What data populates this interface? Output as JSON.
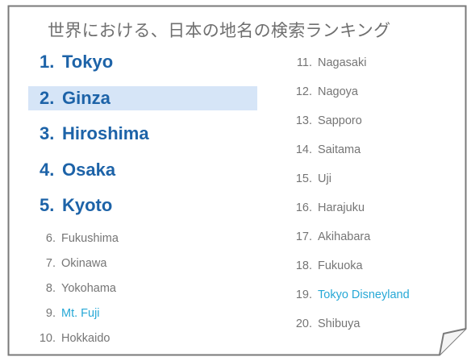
{
  "title": "世界における、日本の地名の検索ランキング",
  "colors": {
    "top_rank": "#1d63a8",
    "link": "#26a8d6",
    "text": "#757575",
    "highlight": "#d6e5f7",
    "border": "#808080"
  },
  "top_items": [
    {
      "rank": "1.",
      "name": "Tokyo"
    },
    {
      "rank": "2.",
      "name": "Ginza",
      "highlighted": true
    },
    {
      "rank": "3.",
      "name": "Hiroshima"
    },
    {
      "rank": "4.",
      "name": "Osaka"
    },
    {
      "rank": "5.",
      "name": "Kyoto"
    }
  ],
  "left_items": [
    {
      "rank": "6.",
      "name": "Fukushima"
    },
    {
      "rank": "7.",
      "name": "Okinawa"
    },
    {
      "rank": "8.",
      "name": "Yokohama"
    },
    {
      "rank": "9.",
      "name": "Mt. Fuji",
      "link": true
    },
    {
      "rank": "10.",
      "name": "Hokkaido"
    }
  ],
  "right_items": [
    {
      "rank": "11.",
      "name": "Nagasaki"
    },
    {
      "rank": "12.",
      "name": "Nagoya"
    },
    {
      "rank": "13.",
      "name": "Sapporo"
    },
    {
      "rank": "14.",
      "name": "Saitama"
    },
    {
      "rank": "15.",
      "name": "Uji"
    },
    {
      "rank": "16.",
      "name": "Harajuku"
    },
    {
      "rank": "17.",
      "name": "Akihabara"
    },
    {
      "rank": "18.",
      "name": "Fukuoka"
    },
    {
      "rank": "19.",
      "name": "Tokyo Disneyland",
      "link": true
    },
    {
      "rank": "20.",
      "name": "Shibuya"
    }
  ]
}
